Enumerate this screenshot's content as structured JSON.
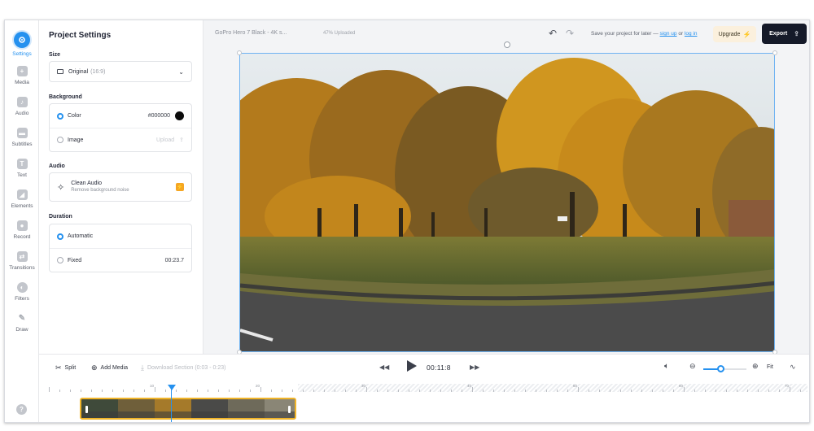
{
  "sidebar": {
    "items": [
      {
        "label": "Settings",
        "icon": "settings-icon",
        "active": true
      },
      {
        "label": "Media",
        "icon": "plus-icon"
      },
      {
        "label": "Audio",
        "icon": "music-note-icon"
      },
      {
        "label": "Subtitles",
        "icon": "subtitles-icon"
      },
      {
        "label": "Text",
        "icon": "text-icon"
      },
      {
        "label": "Elements",
        "icon": "elements-icon"
      },
      {
        "label": "Record",
        "icon": "record-icon"
      },
      {
        "label": "Transitions",
        "icon": "transitions-icon"
      },
      {
        "label": "Filters",
        "icon": "filters-icon"
      },
      {
        "label": "Draw",
        "icon": "pen-icon"
      }
    ],
    "help_icon": "?"
  },
  "panel": {
    "title": "Project Settings",
    "size": {
      "label": "Size",
      "value": "Original",
      "ratio": "(16:9)"
    },
    "background": {
      "label": "Background",
      "color_label": "Color",
      "color_value": "#000000",
      "image_label": "Image",
      "upload_label": "Upload"
    },
    "audio": {
      "label": "Audio",
      "title": "Clean Audio",
      "subtitle": "Remove background noise"
    },
    "duration": {
      "label": "Duration",
      "automatic_label": "Automatic",
      "fixed_label": "Fixed",
      "fixed_value": "00:23.7"
    }
  },
  "topbar": {
    "project_name": "GoPro Hero 7 Black - 4K s...",
    "upload_status": "47% Uploaded",
    "save_note_prefix": "Save your project for later —",
    "sign_up": "sign up",
    "or": "or",
    "log_in": "log in",
    "upgrade_label": "Upgrade",
    "export_label": "Export"
  },
  "transport": {
    "split_label": "Split",
    "add_media_label": "Add Media",
    "download_label": "Download Section (0:03 - 0:23)",
    "time": "00:11:8",
    "fit_label": "Fit",
    "zoom_level": 0.4
  },
  "timeline": {
    "ruler_labels": [
      "10",
      "20",
      "30",
      "40",
      "50",
      "60",
      "70",
      "80",
      "90"
    ]
  },
  "colors": {
    "accent": "#2591ef",
    "export_bg": "#151a29",
    "clip_border": "#f0b429",
    "upgrade_bg": "#fbf0dd"
  }
}
